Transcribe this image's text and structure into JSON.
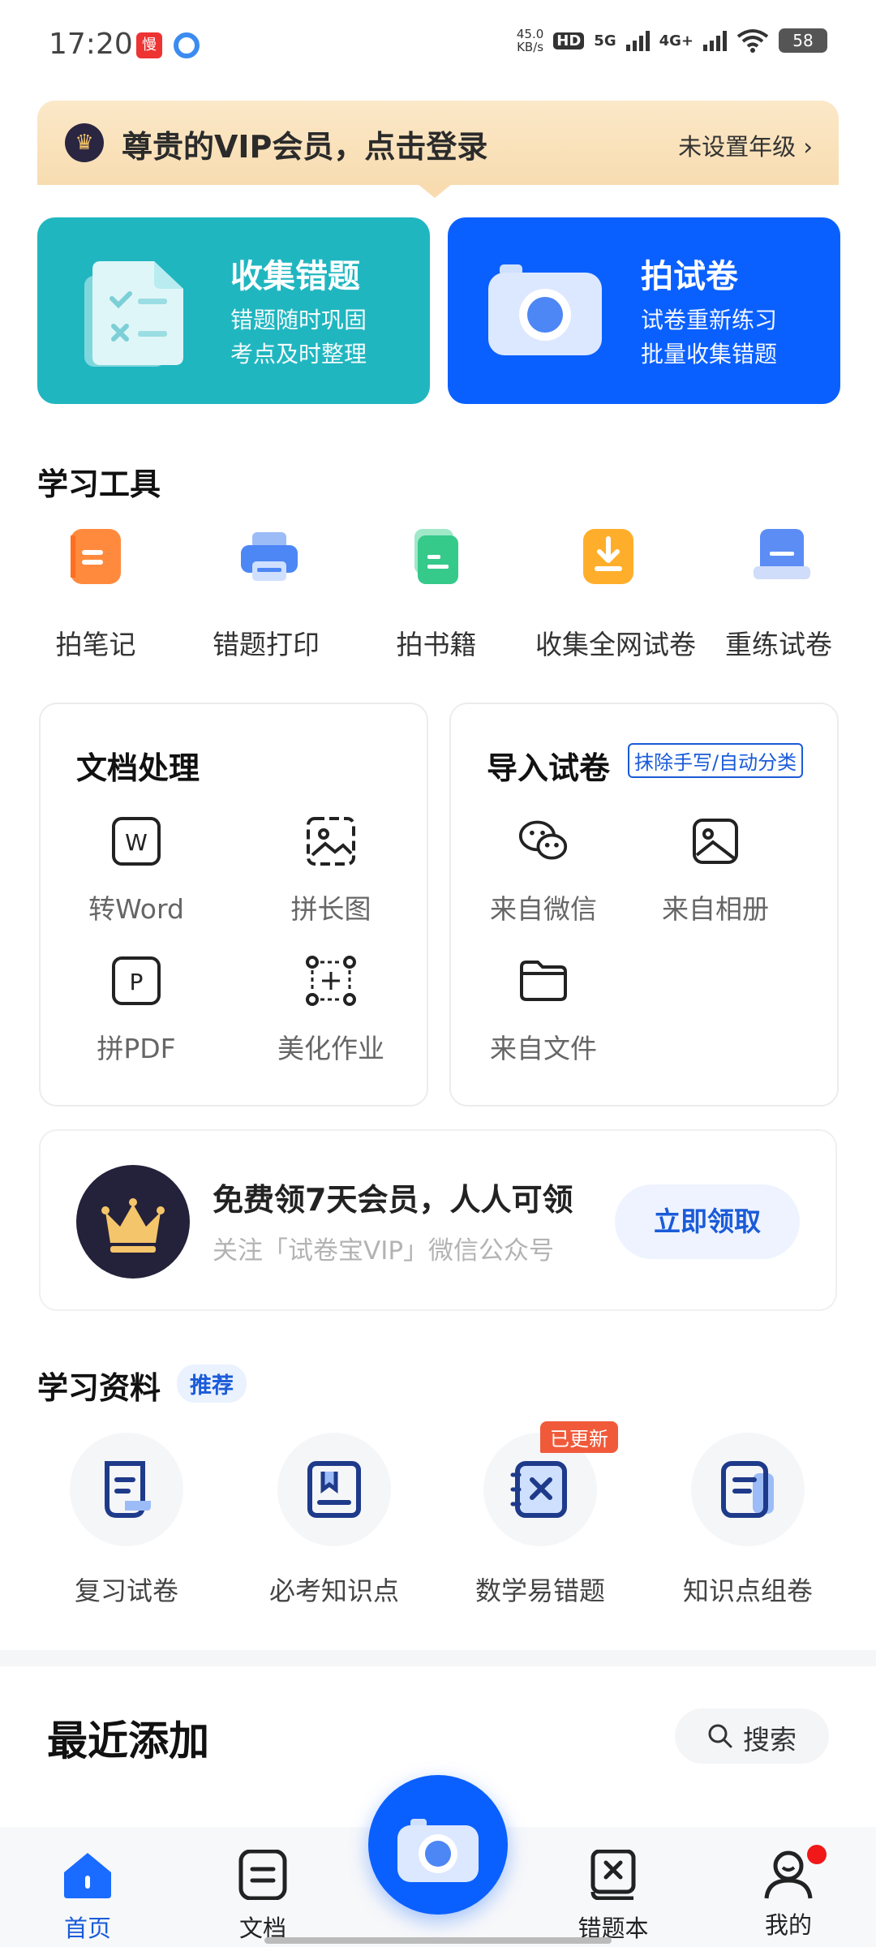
{
  "status_bar": {
    "time": "17:20",
    "net_speed_value": "45.0",
    "net_speed_unit": "KB/s",
    "hd_label": "HD",
    "net_5g": "5G",
    "net_4g": "4G+",
    "battery": "58"
  },
  "vip_banner": {
    "title": "尊贵的VIP会员，点击登录",
    "grade": "未设置年级 ›"
  },
  "feature_cards": [
    {
      "title": "收集错题",
      "line1": "错题随时巩固",
      "line2": "考点及时整理"
    },
    {
      "title": "拍试卷",
      "line1": "试卷重新练习",
      "line2": "批量收集错题"
    }
  ],
  "tools": {
    "title": "学习工具",
    "items": [
      {
        "label": "拍笔记",
        "icon": "notebook-icon"
      },
      {
        "label": "错题打印",
        "icon": "printer-icon"
      },
      {
        "label": "拍书籍",
        "icon": "book-icon"
      },
      {
        "label": "收集全网试卷",
        "icon": "download-icon"
      },
      {
        "label": "重练试卷",
        "icon": "paper-stack-icon"
      }
    ]
  },
  "doc_panel": {
    "title": "文档处理",
    "items": [
      {
        "label": "转Word",
        "icon": "word-icon",
        "glyph": "W"
      },
      {
        "label": "拼长图",
        "icon": "image-icon"
      },
      {
        "label": "拼PDF",
        "icon": "pdf-icon",
        "glyph": "P"
      },
      {
        "label": "美化作业",
        "icon": "crop-icon"
      }
    ]
  },
  "import_panel": {
    "title": "导入试卷",
    "tag": "抹除手写/自动分类",
    "items": [
      {
        "label": "来自微信",
        "icon": "wechat-icon"
      },
      {
        "label": "来自相册",
        "icon": "album-icon"
      },
      {
        "label": "来自文件",
        "icon": "folder-icon"
      }
    ]
  },
  "promo": {
    "title": "免费领7天会员，人人可领",
    "subtitle": "关注「试卷宝VIP」微信公众号",
    "button": "立即领取"
  },
  "resources": {
    "title": "学习资料",
    "badge": "推荐",
    "updated_badge": "已更新",
    "items": [
      {
        "label": "复习试卷",
        "icon": "review-paper-icon"
      },
      {
        "label": "必考知识点",
        "icon": "bookmark-icon"
      },
      {
        "label": "数学易错题",
        "icon": "math-mistake-icon"
      },
      {
        "label": "知识点组卷",
        "icon": "compose-paper-icon"
      }
    ]
  },
  "recent": {
    "title": "最近添加",
    "search_label": "搜索"
  },
  "tabbar": {
    "items": [
      {
        "label": "首页",
        "icon": "home-icon",
        "active": true
      },
      {
        "label": "文档",
        "icon": "document-icon"
      },
      {
        "label": "错题本",
        "icon": "mistake-book-icon"
      },
      {
        "label": "我的",
        "icon": "profile-icon"
      }
    ]
  },
  "colors": {
    "primary_blue": "#0a60ff",
    "teal": "#20b6c0",
    "vip_gold": "#f8dcb0",
    "badge_orange": "#f05a3a"
  }
}
